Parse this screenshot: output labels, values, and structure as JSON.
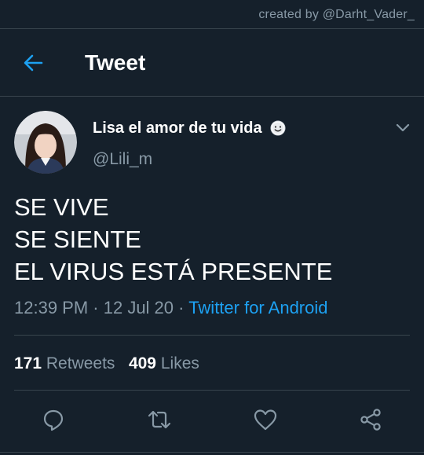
{
  "watermark": "created by @Darht_Vader_",
  "header": {
    "title": "Tweet",
    "back_icon": "arrow-left-icon"
  },
  "author": {
    "display_name": "Lisa el amor de tu vida",
    "handle": "@Lili_m",
    "name_emoji": "smiling-face-emoji"
  },
  "tweet": {
    "lines": [
      "SE VIVE",
      "SE SIENTE",
      "EL VIRUS ESTÁ PRESENTE"
    ]
  },
  "meta": {
    "time": "12:39 PM",
    "dot1": " · ",
    "date": "12 Jul 20",
    "dot2": " · ",
    "source": "Twitter for Android"
  },
  "stats": {
    "retweets_count": "171",
    "retweets_label": "Retweets",
    "likes_count": "409",
    "likes_label": "Likes"
  },
  "actions": [
    "reply-icon",
    "retweet-icon",
    "like-icon",
    "share-icon"
  ],
  "colors": {
    "background": "#15202b",
    "accent": "#1da1f2",
    "secondary_text": "#8899a6",
    "divider": "#38444d"
  }
}
